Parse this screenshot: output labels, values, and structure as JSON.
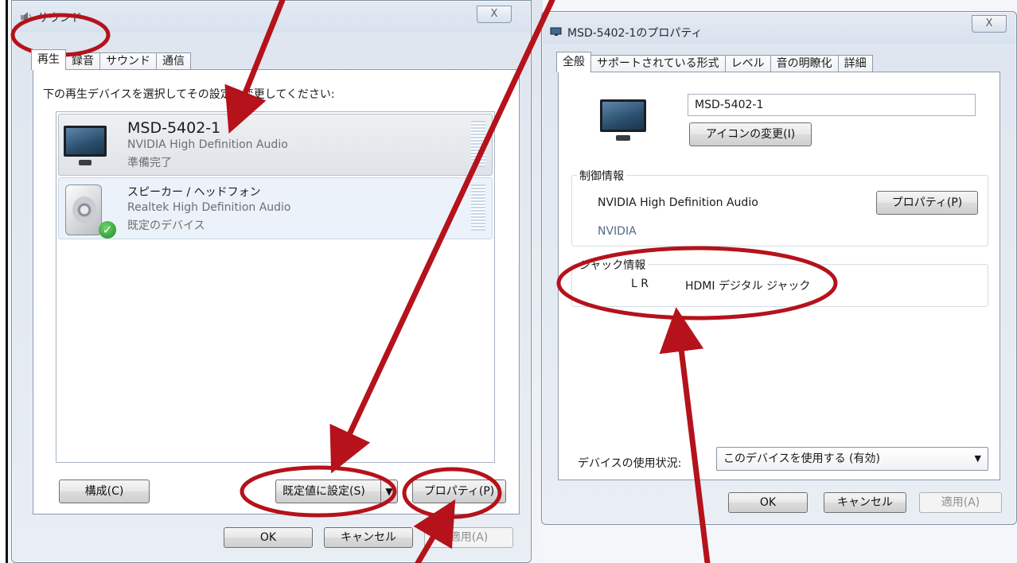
{
  "sound_window": {
    "title": "サウンド",
    "close_label": "X",
    "tabs": [
      "再生",
      "録音",
      "サウンド",
      "通信"
    ],
    "instruction": "下の再生デバイスを選択してその設定を変更してください:",
    "devices": [
      {
        "name": "MSD-5402-1",
        "driver": "NVIDIA High Definition Audio",
        "status": "準備完了",
        "icon": "monitor-icon"
      },
      {
        "name": "スピーカー / ヘッドフォン",
        "driver": "Realtek High Definition Audio",
        "status": "既定のデバイス",
        "icon": "speaker-icon"
      }
    ],
    "configure_button": "構成(C)",
    "set_default_button": "既定値に設定(S)",
    "properties_button": "プロパティ(P)",
    "ok_button": "OK",
    "cancel_button": "キャンセル",
    "apply_button": "適用(A)"
  },
  "properties_window": {
    "title": "MSD-5402-1のプロパティ",
    "close_label": "X",
    "tabs": [
      "全般",
      "サポートされている形式",
      "レベル",
      "音の明瞭化",
      "詳細"
    ],
    "device_name": "MSD-5402-1",
    "change_icon_button": "アイコンの変更(I)",
    "controller_group": "制御情報",
    "controller_name": "NVIDIA High Definition Audio",
    "controller_properties_button": "プロパティ(P)",
    "vendor_link": "NVIDIA",
    "jack_group": "ジャック情報",
    "jack_channels": "L R",
    "jack_type": "HDMI デジタル ジャック",
    "usage_label": "デバイスの使用状況:",
    "usage_value": "このデバイスを使用する (有効)",
    "ok_button": "OK",
    "cancel_button": "キャンセル",
    "apply_button": "適用(A)"
  },
  "colors": {
    "annotation": "#b5121b",
    "window_frame": "#dfe6ef",
    "selected_row": "#dfe3e8"
  }
}
